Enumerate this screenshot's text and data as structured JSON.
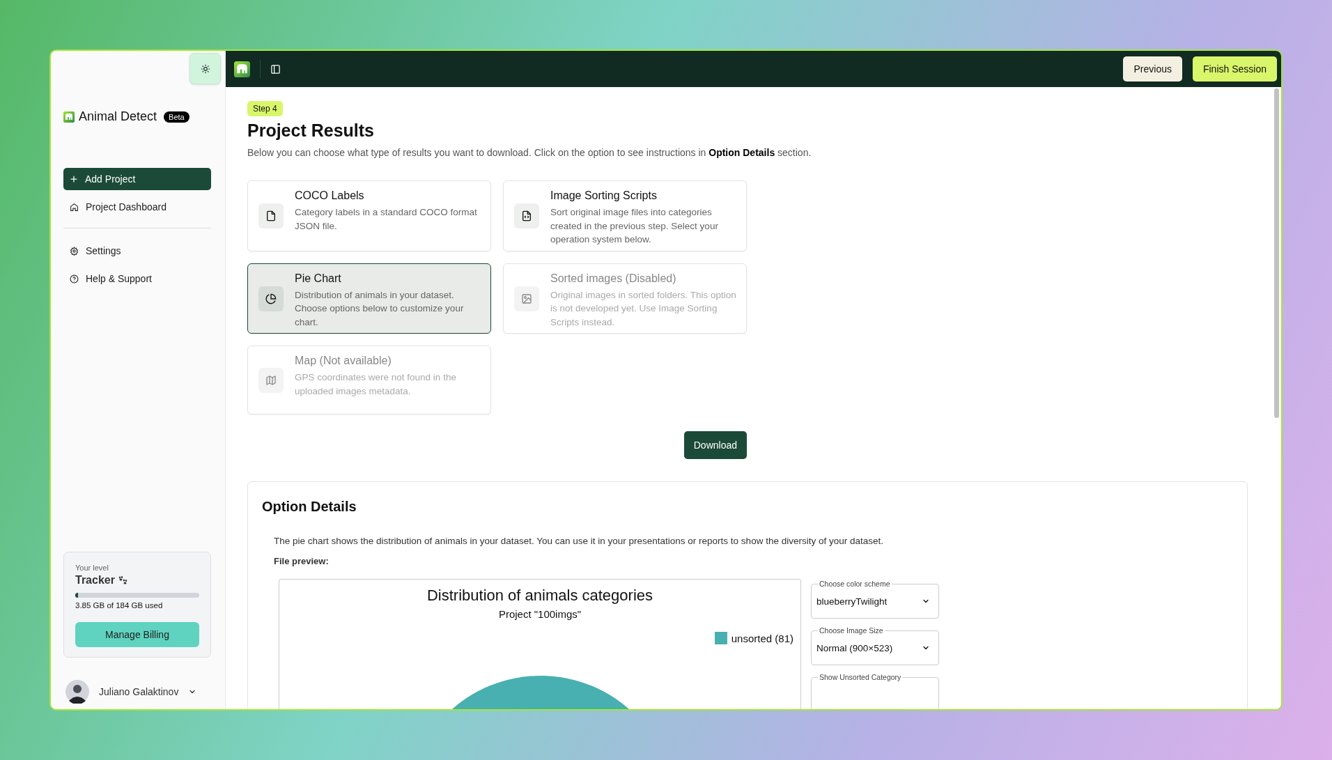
{
  "brand": {
    "name": "Animal Detect",
    "badge": "Beta"
  },
  "nav_main": [
    {
      "label": "Add Project",
      "kind": "primary"
    },
    {
      "label": "Project Dashboard",
      "kind": "link"
    }
  ],
  "nav_secondary": [
    {
      "label": "Settings"
    },
    {
      "label": "Help & Support"
    }
  ],
  "level_card": {
    "caption": "Your level",
    "level_name": "Tracker",
    "level": 0.021,
    "usage": "3.85 GB of 184 GB used",
    "button": "Manage Billing"
  },
  "user": {
    "name": "Juliano Galaktinov"
  },
  "topbar": {
    "buttons": [
      {
        "label": "Previous",
        "kind": "secondary"
      },
      {
        "label": "Finish Session",
        "kind": "primary"
      }
    ]
  },
  "page": {
    "step": "Step 4",
    "title": "Project Results",
    "description": "Below you can choose what type of results you want to download. Click on the option to see instructions in **Option Details** section."
  },
  "options": [
    {
      "title": "COCO Labels",
      "description": "Category labels in a standard COCO format JSON file.",
      "selected": false,
      "disabled": false
    },
    {
      "title": "Image Sorting Scripts",
      "description": "Sort original image files into categories created in the previous step. Select your operation system below.",
      "selected": false,
      "disabled": false
    },
    {
      "title": "Pie Chart",
      "description": "Distribution of animals in your dataset. Choose options below to customize your chart.",
      "selected": true,
      "disabled": false
    },
    {
      "title": "Sorted images (Disabled)",
      "description": "Original images in sorted folders. This option is not developed yet. Use Image Sorting Scripts instead.",
      "selected": false,
      "disabled": true
    },
    {
      "title": "Map (Not available)",
      "description": "GPS coordinates were not found in the uploaded images metadata.",
      "selected": false,
      "disabled": true
    }
  ],
  "download_button": "Download",
  "details": {
    "title": "Option Details",
    "text": "The pie chart shows the distribution of animals in your dataset. You can use it in your presentations or reports to show the diversity of your dataset.",
    "preview_label": "File preview:",
    "chart": {
      "title": "Distribution of animals categories",
      "subtitle": "Project \"100imgs\"",
      "legend": [
        {
          "label": "unsorted (81)",
          "color": "#48b0b0"
        }
      ]
    },
    "controls": [
      {
        "label": "Choose color scheme",
        "value": "blueberryTwilight"
      },
      {
        "label": "Choose Image Size",
        "value": "Normal (900×523)"
      },
      {
        "label": "Show Unsorted Category"
      }
    ]
  }
}
